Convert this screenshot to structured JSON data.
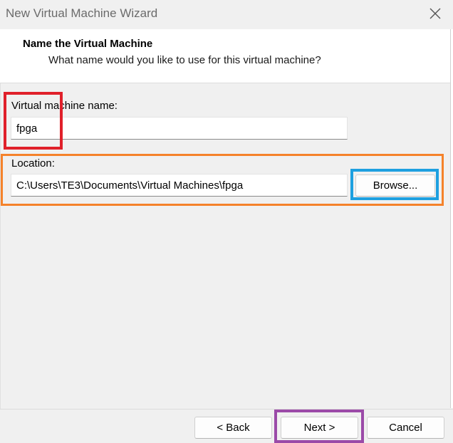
{
  "window": {
    "title": "New Virtual Machine Wizard"
  },
  "header": {
    "title": "Name the Virtual Machine",
    "subtitle": "What name would you like to use for this virtual machine?"
  },
  "form": {
    "vm_name_label": "Virtual machine name:",
    "vm_name_value": "fpga",
    "location_label": "Location:",
    "location_value": "C:\\Users\\TE3\\Documents\\Virtual Machines\\fpga",
    "browse_label": "Browse..."
  },
  "footer": {
    "back_label": "< Back",
    "next_label": "Next >",
    "cancel_label": "Cancel"
  },
  "annotations": {
    "red": "#e0202a",
    "orange": "#f5822a",
    "blue": "#1ea0e0",
    "purple": "#9b4aa8"
  },
  "icons": {
    "close": "close-icon"
  }
}
